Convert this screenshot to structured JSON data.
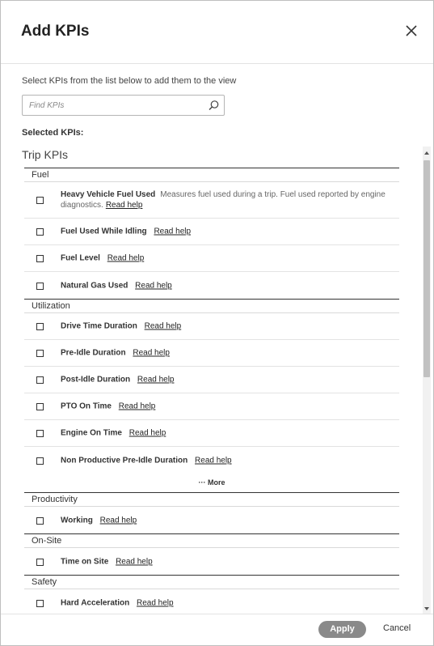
{
  "dialog": {
    "title": "Add KPIs",
    "close_icon": "close-icon",
    "instructions": "Select KPIs from the list below to add them to the view",
    "search": {
      "placeholder": "Find KPIs",
      "value": "",
      "icon": "search-icon"
    },
    "selected_label": "Selected KPIs:",
    "group_title": "Trip KPIs",
    "help_label": "Read help",
    "more_label": "··· More",
    "sections": {
      "fuel": {
        "title": "Fuel",
        "items": [
          {
            "name": "Heavy Vehicle Fuel Used",
            "description": "Measures fuel used during a trip. Fuel used reported by engine diagnostics."
          },
          {
            "name": "Fuel Used While Idling"
          },
          {
            "name": "Fuel Level"
          },
          {
            "name": "Natural Gas Used"
          }
        ]
      },
      "utilization": {
        "title": "Utilization",
        "items": [
          {
            "name": "Drive Time Duration"
          },
          {
            "name": "Pre-Idle Duration"
          },
          {
            "name": "Post-Idle Duration"
          },
          {
            "name": "PTO On Time"
          },
          {
            "name": "Engine On Time"
          },
          {
            "name": "Non Productive Pre-Idle Duration"
          }
        ]
      },
      "productivity": {
        "title": "Productivity",
        "items": [
          {
            "name": "Working"
          }
        ]
      },
      "onsite": {
        "title": "On-Site",
        "items": [
          {
            "name": "Time on Site"
          }
        ]
      },
      "safety": {
        "title": "Safety",
        "items": [
          {
            "name": "Hard Acceleration"
          }
        ]
      }
    },
    "footer": {
      "apply_label": "Apply",
      "cancel_label": "Cancel"
    },
    "colors": {
      "apply_bg": "#8a8a8a",
      "section_rule": "#333333"
    }
  }
}
